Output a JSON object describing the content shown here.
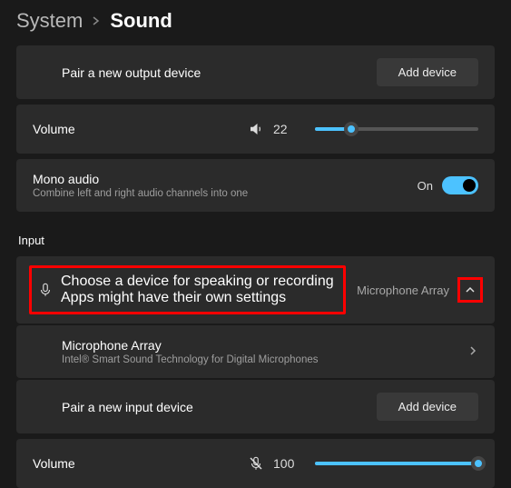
{
  "breadcrumb": {
    "parent": "System",
    "current": "Sound"
  },
  "output": {
    "pair_label": "Pair a new output device",
    "add_button": "Add device",
    "volume_label": "Volume",
    "volume_value": "22",
    "mono_title": "Mono audio",
    "mono_subtitle": "Combine left and right audio channels into one",
    "mono_state": "On"
  },
  "input_section_label": "Input",
  "input": {
    "choose_title": "Choose a device for speaking or recording",
    "choose_subtitle": "Apps might have their own settings",
    "selected_device": "Microphone Array",
    "device_name": "Microphone Array",
    "device_desc": "Intel® Smart Sound Technology for Digital Microphones",
    "pair_label": "Pair a new input device",
    "add_button": "Add device",
    "volume_label": "Volume",
    "volume_value": "100"
  }
}
